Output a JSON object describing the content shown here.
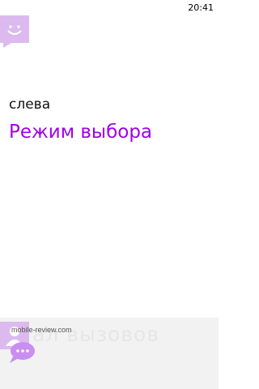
{
  "status": {
    "time": "20:41"
  },
  "content": {
    "side_label": "слева",
    "mode_title": "Режим выбора"
  },
  "background": {
    "ghost_text": "ал вызовов"
  },
  "watermark": {
    "text": "mobile-review.com"
  },
  "colors": {
    "accent": "#a100e8",
    "tile": "#dcbaf0",
    "bubble": "#c98ff0"
  },
  "icons": {
    "top_tile": "smiley-chat-icon",
    "people_tile": "person-icon",
    "bottom_button": "message-bubble-icon"
  }
}
